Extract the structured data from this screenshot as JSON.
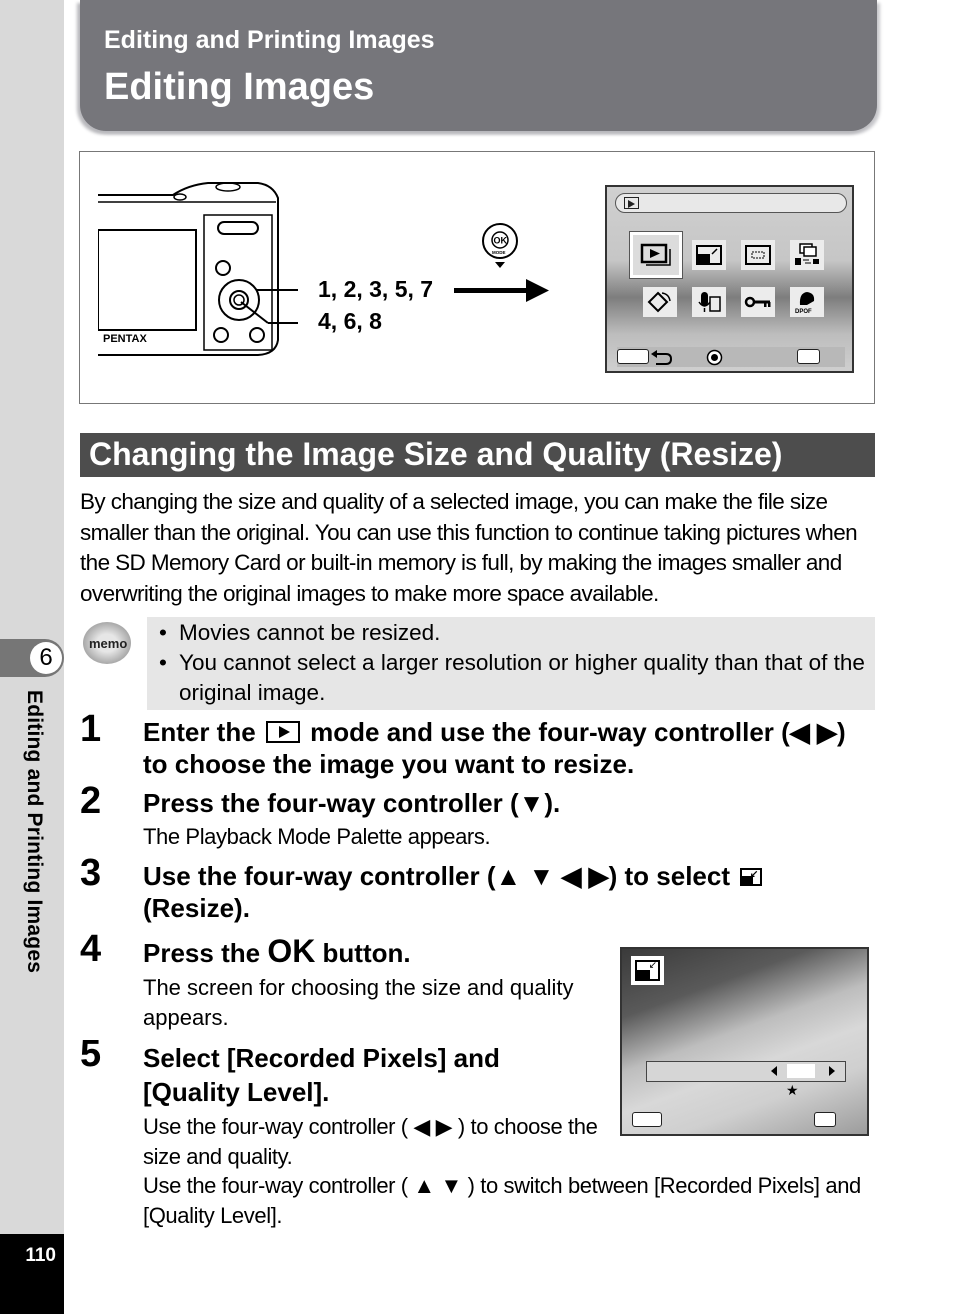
{
  "sidebar": {
    "chapter_number": "6",
    "chapter_title": "Editing and Printing Images",
    "page_number": "110"
  },
  "header": {
    "subtitle": "Editing and Printing Images",
    "title": "Editing Images"
  },
  "figure": {
    "camera_brand": "PENTAX",
    "callout_top": "1, 2, 3, 5, 7",
    "callout_bottom": "4, 6, 8",
    "ok_button_label": "OK",
    "ok_button_sublabel": "MODE",
    "palette_icons": [
      "playback-icon",
      "resize-icon",
      "cropping-icon",
      "image-copy-icon",
      "rotate-icon",
      "voice-memo-icon",
      "protect-icon",
      "dpof-icon"
    ],
    "dpof_label": "DPOF"
  },
  "section": {
    "heading": "Changing the Image Size and Quality (Resize)",
    "intro": "By changing the size and quality of a selected image, you can make the file size smaller than the original. You can use this function to continue taking pictures when the SD Memory Card or built-in memory is full, by making the images smaller and overwriting the original images to make more space available."
  },
  "memo": {
    "icon_label": "memo",
    "items": [
      "Movies cannot be resized.",
      "You cannot select a larger resolution or higher quality than that of the original image."
    ]
  },
  "steps": [
    {
      "number": "1",
      "title_pre": "Enter the",
      "title_post": "mode and use the four-way controller (◀ ▶) to choose the image you want to resize."
    },
    {
      "number": "2",
      "title": "Press the four-way controller (▼).",
      "body": "The Playback Mode Palette appears."
    },
    {
      "number": "3",
      "title_pre": "Use the four-way controller (▲ ▼ ◀ ▶) to select",
      "title_post": "(Resize)."
    },
    {
      "number": "4",
      "title_pre": "Press the",
      "title_ok": "OK",
      "title_post": "button.",
      "body": "The screen for choosing the size and quality appears."
    },
    {
      "number": "5",
      "title": "Select [Recorded Pixels] and [Quality Level].",
      "body1": "Use the four-way controller ( ◀ ▶ ) to choose the size and quality.",
      "body2": "Use the four-way controller ( ▲ ▼ ) to switch between [Recorded Pixels] and [Quality Level]."
    }
  ]
}
